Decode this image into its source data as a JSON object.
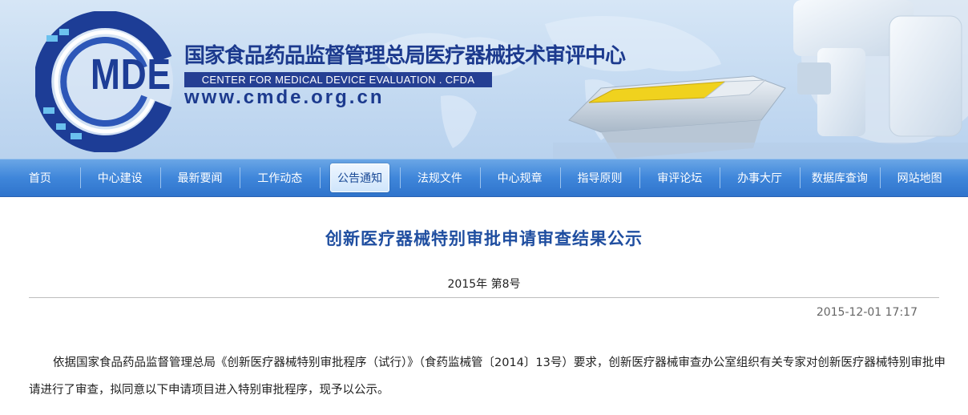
{
  "header": {
    "logo_text": "MDE",
    "title_cn": "国家食品药品监督管理总局医疗器械技术审评中心",
    "title_en": "CENTER FOR MEDICAL DEVICE EVALUATION . CFDA",
    "url": "www.cmde.org.cn"
  },
  "nav": {
    "items": [
      {
        "label": "首页"
      },
      {
        "label": "中心建设"
      },
      {
        "label": "最新要闻"
      },
      {
        "label": "工作动态"
      },
      {
        "label": "公告通知"
      },
      {
        "label": "法规文件"
      },
      {
        "label": "中心规章"
      },
      {
        "label": "指导原则"
      },
      {
        "label": "审评论坛"
      },
      {
        "label": "办事大厅"
      },
      {
        "label": "数据库查询"
      },
      {
        "label": "网站地图"
      }
    ],
    "active": "公告通知"
  },
  "article": {
    "title": "创新医疗器械特别审批申请审查结果公示",
    "doc_number": "2015年 第8号",
    "date": "2015-12-01 17:17",
    "paragraph": "依据国家食品药品监督管理总局《创新医疗器械特别审批程序（试行）》（食药监械管〔2014〕13号）要求，创新医疗器械审查办公室组织有关专家对创新医疗器械特别审批申请进行了审查，拟同意以下申请项目进入特别审批程序，现予以公示。"
  },
  "colors": {
    "brand_blue": "#1c3a8e",
    "nav_blue": "#3f86da",
    "title_blue": "#1f4ea0"
  }
}
